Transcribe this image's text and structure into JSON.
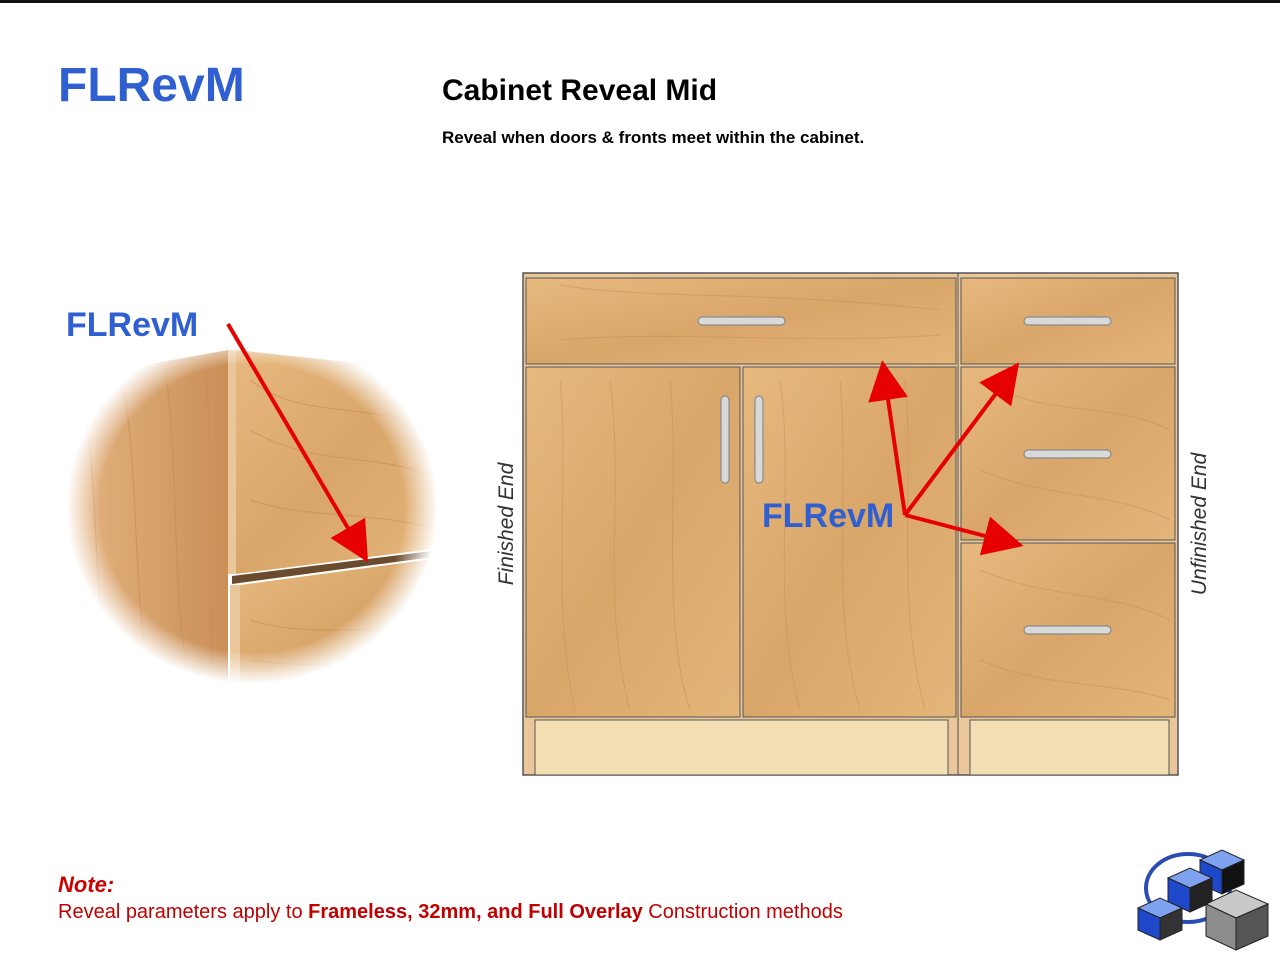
{
  "header": {
    "code": "FLRevM",
    "title": "Cabinet Reveal Mid",
    "subtitle": "Reveal when doors & fronts meet within the cabinet."
  },
  "zoom_view": {
    "label": "FLRevM"
  },
  "diagram": {
    "label": "FLRevM",
    "left_side": "Finished End",
    "right_side": "Unfinished End"
  },
  "note": {
    "title": "Note:",
    "text_before": "Reveal parameters apply to ",
    "text_bold": "Frameless, 32mm, and Full Overlay",
    "text_after": " Construction methods"
  },
  "colors": {
    "accent_blue": "#2f5fd0",
    "arrow_red": "#e60000",
    "note_red": "#c00000",
    "wood": "#dcaa6e",
    "toe_kick": "#f4dfb5"
  },
  "icons": [
    "logo-cubes-icon"
  ]
}
